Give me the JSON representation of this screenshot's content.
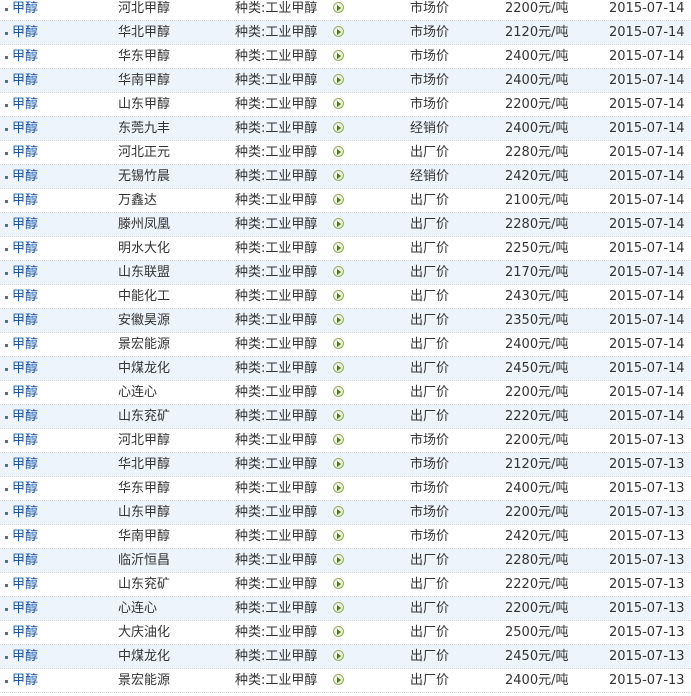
{
  "rows": [
    {
      "product": "甲醇",
      "region": "河北甲醇",
      "category": "种类:工业甲醇",
      "price_type": "市场价",
      "price": "2200元/吨",
      "date": "2015-07-14"
    },
    {
      "product": "甲醇",
      "region": "华北甲醇",
      "category": "种类:工业甲醇",
      "price_type": "市场价",
      "price": "2120元/吨",
      "date": "2015-07-14"
    },
    {
      "product": "甲醇",
      "region": "华东甲醇",
      "category": "种类:工业甲醇",
      "price_type": "市场价",
      "price": "2400元/吨",
      "date": "2015-07-14"
    },
    {
      "product": "甲醇",
      "region": "华南甲醇",
      "category": "种类:工业甲醇",
      "price_type": "市场价",
      "price": "2400元/吨",
      "date": "2015-07-14"
    },
    {
      "product": "甲醇",
      "region": "山东甲醇",
      "category": "种类:工业甲醇",
      "price_type": "市场价",
      "price": "2200元/吨",
      "date": "2015-07-14"
    },
    {
      "product": "甲醇",
      "region": "东莞九丰",
      "category": "种类:工业甲醇",
      "price_type": "经销价",
      "price": "2400元/吨",
      "date": "2015-07-14"
    },
    {
      "product": "甲醇",
      "region": "河北正元",
      "category": "种类:工业甲醇",
      "price_type": "出厂价",
      "price": "2280元/吨",
      "date": "2015-07-14"
    },
    {
      "product": "甲醇",
      "region": "无锡竹晨",
      "category": "种类:工业甲醇",
      "price_type": "经销价",
      "price": "2420元/吨",
      "date": "2015-07-14"
    },
    {
      "product": "甲醇",
      "region": "万鑫达",
      "category": "种类:工业甲醇",
      "price_type": "出厂价",
      "price": "2100元/吨",
      "date": "2015-07-14"
    },
    {
      "product": "甲醇",
      "region": "滕州凤凰",
      "category": "种类:工业甲醇",
      "price_type": "出厂价",
      "price": "2280元/吨",
      "date": "2015-07-14"
    },
    {
      "product": "甲醇",
      "region": "明水大化",
      "category": "种类:工业甲醇",
      "price_type": "出厂价",
      "price": "2250元/吨",
      "date": "2015-07-14"
    },
    {
      "product": "甲醇",
      "region": "山东联盟",
      "category": "种类:工业甲醇",
      "price_type": "出厂价",
      "price": "2170元/吨",
      "date": "2015-07-14"
    },
    {
      "product": "甲醇",
      "region": "中能化工",
      "category": "种类:工业甲醇",
      "price_type": "出厂价",
      "price": "2430元/吨",
      "date": "2015-07-14"
    },
    {
      "product": "甲醇",
      "region": "安徽昊源",
      "category": "种类:工业甲醇",
      "price_type": "出厂价",
      "price": "2350元/吨",
      "date": "2015-07-14"
    },
    {
      "product": "甲醇",
      "region": "景宏能源",
      "category": "种类:工业甲醇",
      "price_type": "出厂价",
      "price": "2400元/吨",
      "date": "2015-07-14"
    },
    {
      "product": "甲醇",
      "region": "中煤龙化",
      "category": "种类:工业甲醇",
      "price_type": "出厂价",
      "price": "2450元/吨",
      "date": "2015-07-14"
    },
    {
      "product": "甲醇",
      "region": "心连心",
      "category": "种类:工业甲醇",
      "price_type": "出厂价",
      "price": "2200元/吨",
      "date": "2015-07-14"
    },
    {
      "product": "甲醇",
      "region": "山东兖矿",
      "category": "种类:工业甲醇",
      "price_type": "出厂价",
      "price": "2220元/吨",
      "date": "2015-07-14"
    },
    {
      "product": "甲醇",
      "region": "河北甲醇",
      "category": "种类:工业甲醇",
      "price_type": "市场价",
      "price": "2200元/吨",
      "date": "2015-07-13"
    },
    {
      "product": "甲醇",
      "region": "华北甲醇",
      "category": "种类:工业甲醇",
      "price_type": "市场价",
      "price": "2120元/吨",
      "date": "2015-07-13"
    },
    {
      "product": "甲醇",
      "region": "华东甲醇",
      "category": "种类:工业甲醇",
      "price_type": "市场价",
      "price": "2400元/吨",
      "date": "2015-07-13"
    },
    {
      "product": "甲醇",
      "region": "山东甲醇",
      "category": "种类:工业甲醇",
      "price_type": "市场价",
      "price": "2200元/吨",
      "date": "2015-07-13"
    },
    {
      "product": "甲醇",
      "region": "华南甲醇",
      "category": "种类:工业甲醇",
      "price_type": "市场价",
      "price": "2420元/吨",
      "date": "2015-07-13"
    },
    {
      "product": "甲醇",
      "region": "临沂恒昌",
      "category": "种类:工业甲醇",
      "price_type": "出厂价",
      "price": "2280元/吨",
      "date": "2015-07-13"
    },
    {
      "product": "甲醇",
      "region": "山东兖矿",
      "category": "种类:工业甲醇",
      "price_type": "出厂价",
      "price": "2220元/吨",
      "date": "2015-07-13"
    },
    {
      "product": "甲醇",
      "region": "心连心",
      "category": "种类:工业甲醇",
      "price_type": "出厂价",
      "price": "2200元/吨",
      "date": "2015-07-13"
    },
    {
      "product": "甲醇",
      "region": "大庆油化",
      "category": "种类:工业甲醇",
      "price_type": "出厂价",
      "price": "2500元/吨",
      "date": "2015-07-13"
    },
    {
      "product": "甲醇",
      "region": "中煤龙化",
      "category": "种类:工业甲醇",
      "price_type": "出厂价",
      "price": "2450元/吨",
      "date": "2015-07-13"
    },
    {
      "product": "甲醇",
      "region": "景宏能源",
      "category": "种类:工业甲醇",
      "price_type": "出厂价",
      "price": "2400元/吨",
      "date": "2015-07-13"
    }
  ],
  "icons": {
    "bullet": "square-bullet-icon",
    "detail_arrow": "arrow-circle-icon"
  },
  "colors": {
    "link": "#1a55a8",
    "alt_row_bg": "#eef4fc",
    "text": "#333333"
  }
}
